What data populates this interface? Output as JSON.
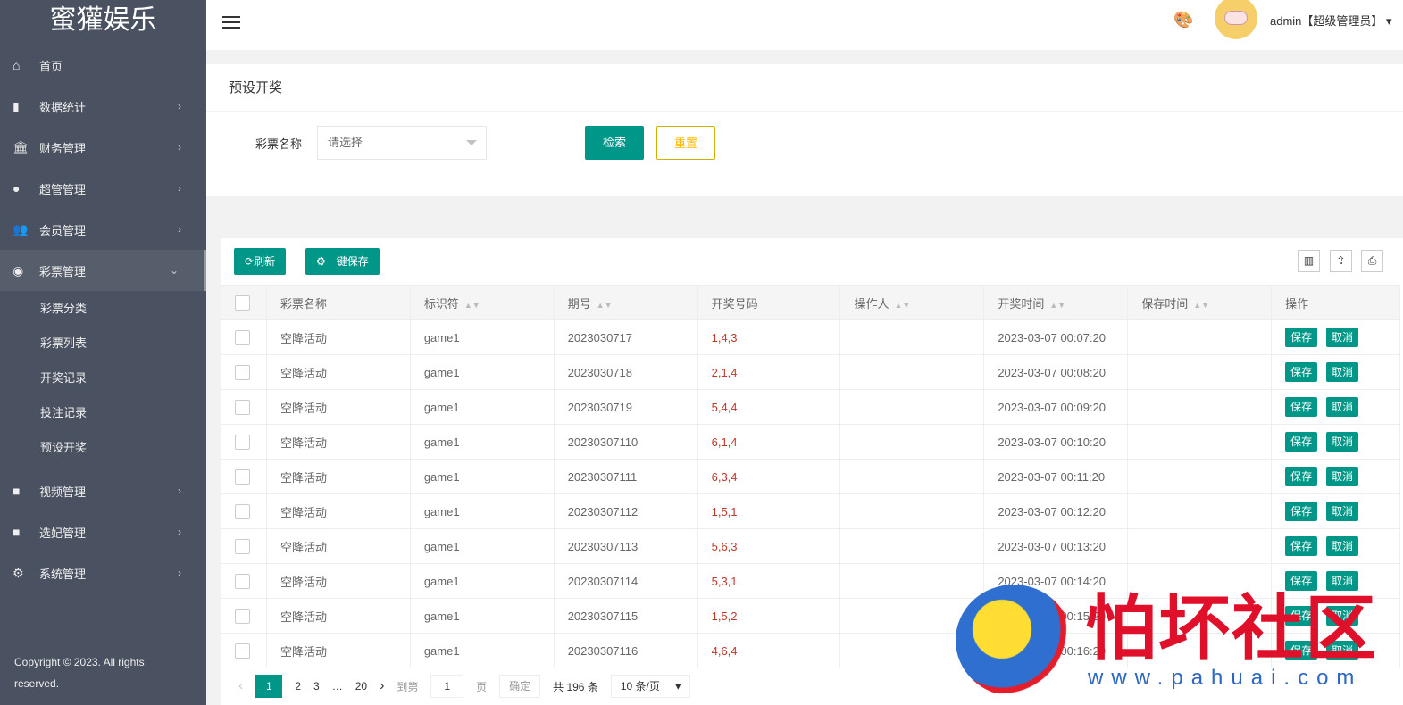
{
  "sidebar": {
    "logo": "蜜獾娱乐",
    "items": [
      {
        "label": "首页",
        "icon": "home-icon"
      },
      {
        "label": "数据统计",
        "icon": "bar-chart-icon"
      },
      {
        "label": "财务管理",
        "icon": "bank-icon"
      },
      {
        "label": "超管管理",
        "icon": "user-icon"
      },
      {
        "label": "会员管理",
        "icon": "users-icon"
      },
      {
        "label": "彩票管理",
        "icon": "gamepad-icon"
      }
    ],
    "sub": [
      "彩票分类",
      "彩票列表",
      "开奖记录",
      "投注记录",
      "预设开奖"
    ],
    "items2": [
      {
        "label": "视频管理",
        "icon": "video-icon"
      },
      {
        "label": "选妃管理",
        "icon": "video-icon"
      },
      {
        "label": "系统管理",
        "icon": "gear-icon"
      }
    ],
    "copyright": "Copyright © 2023. All rights reserved."
  },
  "header": {
    "user": "admin【超级管理员】"
  },
  "search": {
    "title": "预设开奖",
    "label": "彩票名称",
    "placeholder": "请选择",
    "search": "检索",
    "reset": "重置"
  },
  "toolbar": {
    "refresh": "刷新",
    "save_all": "一键保存"
  },
  "table": {
    "headers": [
      "彩票名称",
      "标识符",
      "期号",
      "开奖号码",
      "操作人",
      "开奖时间",
      "保存时间",
      "操作"
    ],
    "save": "保存",
    "cancel": "取消",
    "rows": [
      [
        "空降活动",
        "game1",
        "2023030717",
        "1,4,3",
        "",
        "2023-03-07 00:07:20",
        ""
      ],
      [
        "空降活动",
        "game1",
        "2023030718",
        "2,1,4",
        "",
        "2023-03-07 00:08:20",
        ""
      ],
      [
        "空降活动",
        "game1",
        "2023030719",
        "5,4,4",
        "",
        "2023-03-07 00:09:20",
        ""
      ],
      [
        "空降活动",
        "game1",
        "20230307110",
        "6,1,4",
        "",
        "2023-03-07 00:10:20",
        ""
      ],
      [
        "空降活动",
        "game1",
        "20230307111",
        "6,3,4",
        "",
        "2023-03-07 00:11:20",
        ""
      ],
      [
        "空降活动",
        "game1",
        "20230307112",
        "1,5,1",
        "",
        "2023-03-07 00:12:20",
        ""
      ],
      [
        "空降活动",
        "game1",
        "20230307113",
        "5,6,3",
        "",
        "2023-03-07 00:13:20",
        ""
      ],
      [
        "空降活动",
        "game1",
        "20230307114",
        "5,3,1",
        "",
        "2023-03-07 00:14:20",
        ""
      ],
      [
        "空降活动",
        "game1",
        "20230307115",
        "1,5,2",
        "",
        "2023-03-07 00:15:20",
        ""
      ],
      [
        "空降活动",
        "game1",
        "20230307116",
        "4,6,4",
        "",
        "2023-03-07 00:16:20",
        ""
      ]
    ]
  },
  "pagination": {
    "pages": [
      "1",
      "2",
      "3",
      "…",
      "20"
    ],
    "goto": "到第",
    "page_value": "1",
    "page_unit": "页",
    "confirm": "确定",
    "total": "共 196 条",
    "per_page": "10 条/页"
  },
  "watermark": {
    "text": "怕坏社区",
    "url": "www.pahuai.com"
  }
}
